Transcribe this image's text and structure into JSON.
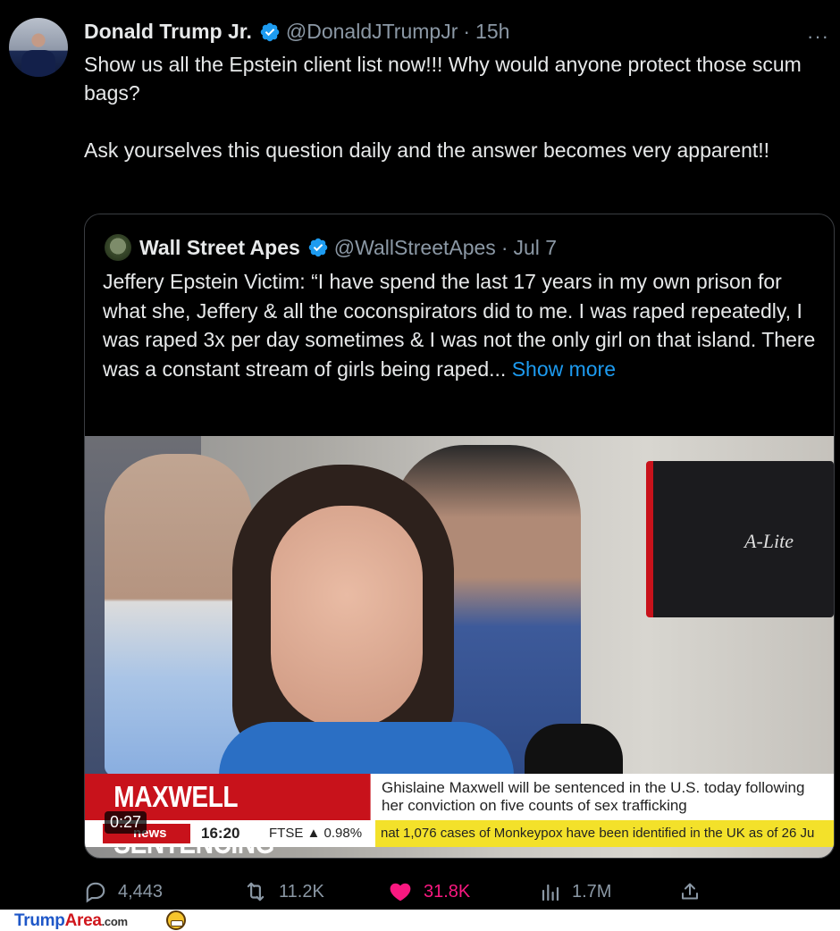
{
  "tweet": {
    "author_name": "Donald Trump Jr.",
    "handle": "@DonaldJTrumpJr",
    "dot": "·",
    "time": "15h",
    "more": "···",
    "paragraph_1": "Show us all the Epstein client list now!!! Why would anyone protect those scum bags?",
    "paragraph_2": "Ask yourselves this question daily and the answer becomes very apparent!!"
  },
  "quote": {
    "author_name": "Wall Street Apes",
    "handle": "@WallStreetApes",
    "dot": "·",
    "time": "Jul 7",
    "text": "Jeffery Epstein Victim: “I have spend the last 17 years in my own prison for what she, Jeffery & all the coconspirators did to me. I was raped repeatedly, I was raped 3x per day sometimes & I was not the only girl on that island. There was a constant stream of girls being raped... ",
    "show_more": "Show more"
  },
  "video": {
    "headline": "MAXWELL SENTENCING",
    "subheadline": "Ghislaine Maxwell will be sentenced in the U.S. today following her conviction on five counts of sex trafficking",
    "ticker_channel": "news",
    "ticker_time": "16:20",
    "ticker_ftse": "FTSE ▲ 0.98%",
    "ticker_news": "nat 1,076 cases of Monkeypox have been identified in the UK as of 26 Ju",
    "duration": "0:27",
    "camera_label": "A-Lite"
  },
  "actions": {
    "replies": "4,443",
    "retweets": "11.2K",
    "likes": "31.8K",
    "views": "1.7M"
  },
  "footer": {
    "brand_part1": "Trump",
    "brand_part2": "Area",
    "brand_suffix": ".com"
  },
  "colors": {
    "background": "#000000",
    "text": "#e7e9ea",
    "muted": "#8b98a5",
    "link": "#1d9bf0",
    "verified": "#1d9bf0",
    "like": "#f91880",
    "sky_red": "#c8121b",
    "ticker_yellow": "#f3e12a"
  }
}
